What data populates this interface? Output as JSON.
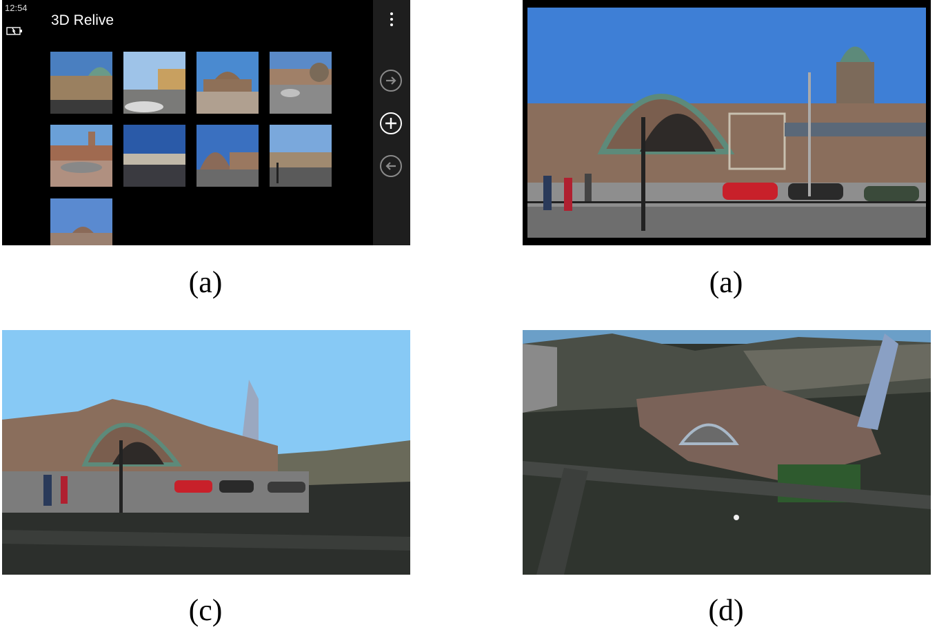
{
  "app": {
    "time": "12:54",
    "title": "3D Relive",
    "icons": {
      "battery": "battery-charging-icon",
      "more": "more-vertical-icon",
      "forward": "arrow-right-circle-icon",
      "add": "plus-circle-icon",
      "back": "arrow-left-circle-icon"
    }
  },
  "captions": {
    "top_left": "(a)",
    "top_right": "(a)",
    "bottom_left": "(c)",
    "bottom_right": "(d)"
  },
  "colors": {
    "sky": "#87c9f5",
    "appbar": "#1e1e1e",
    "building": "#8a6e5c",
    "roof": "#5d8a7a"
  }
}
